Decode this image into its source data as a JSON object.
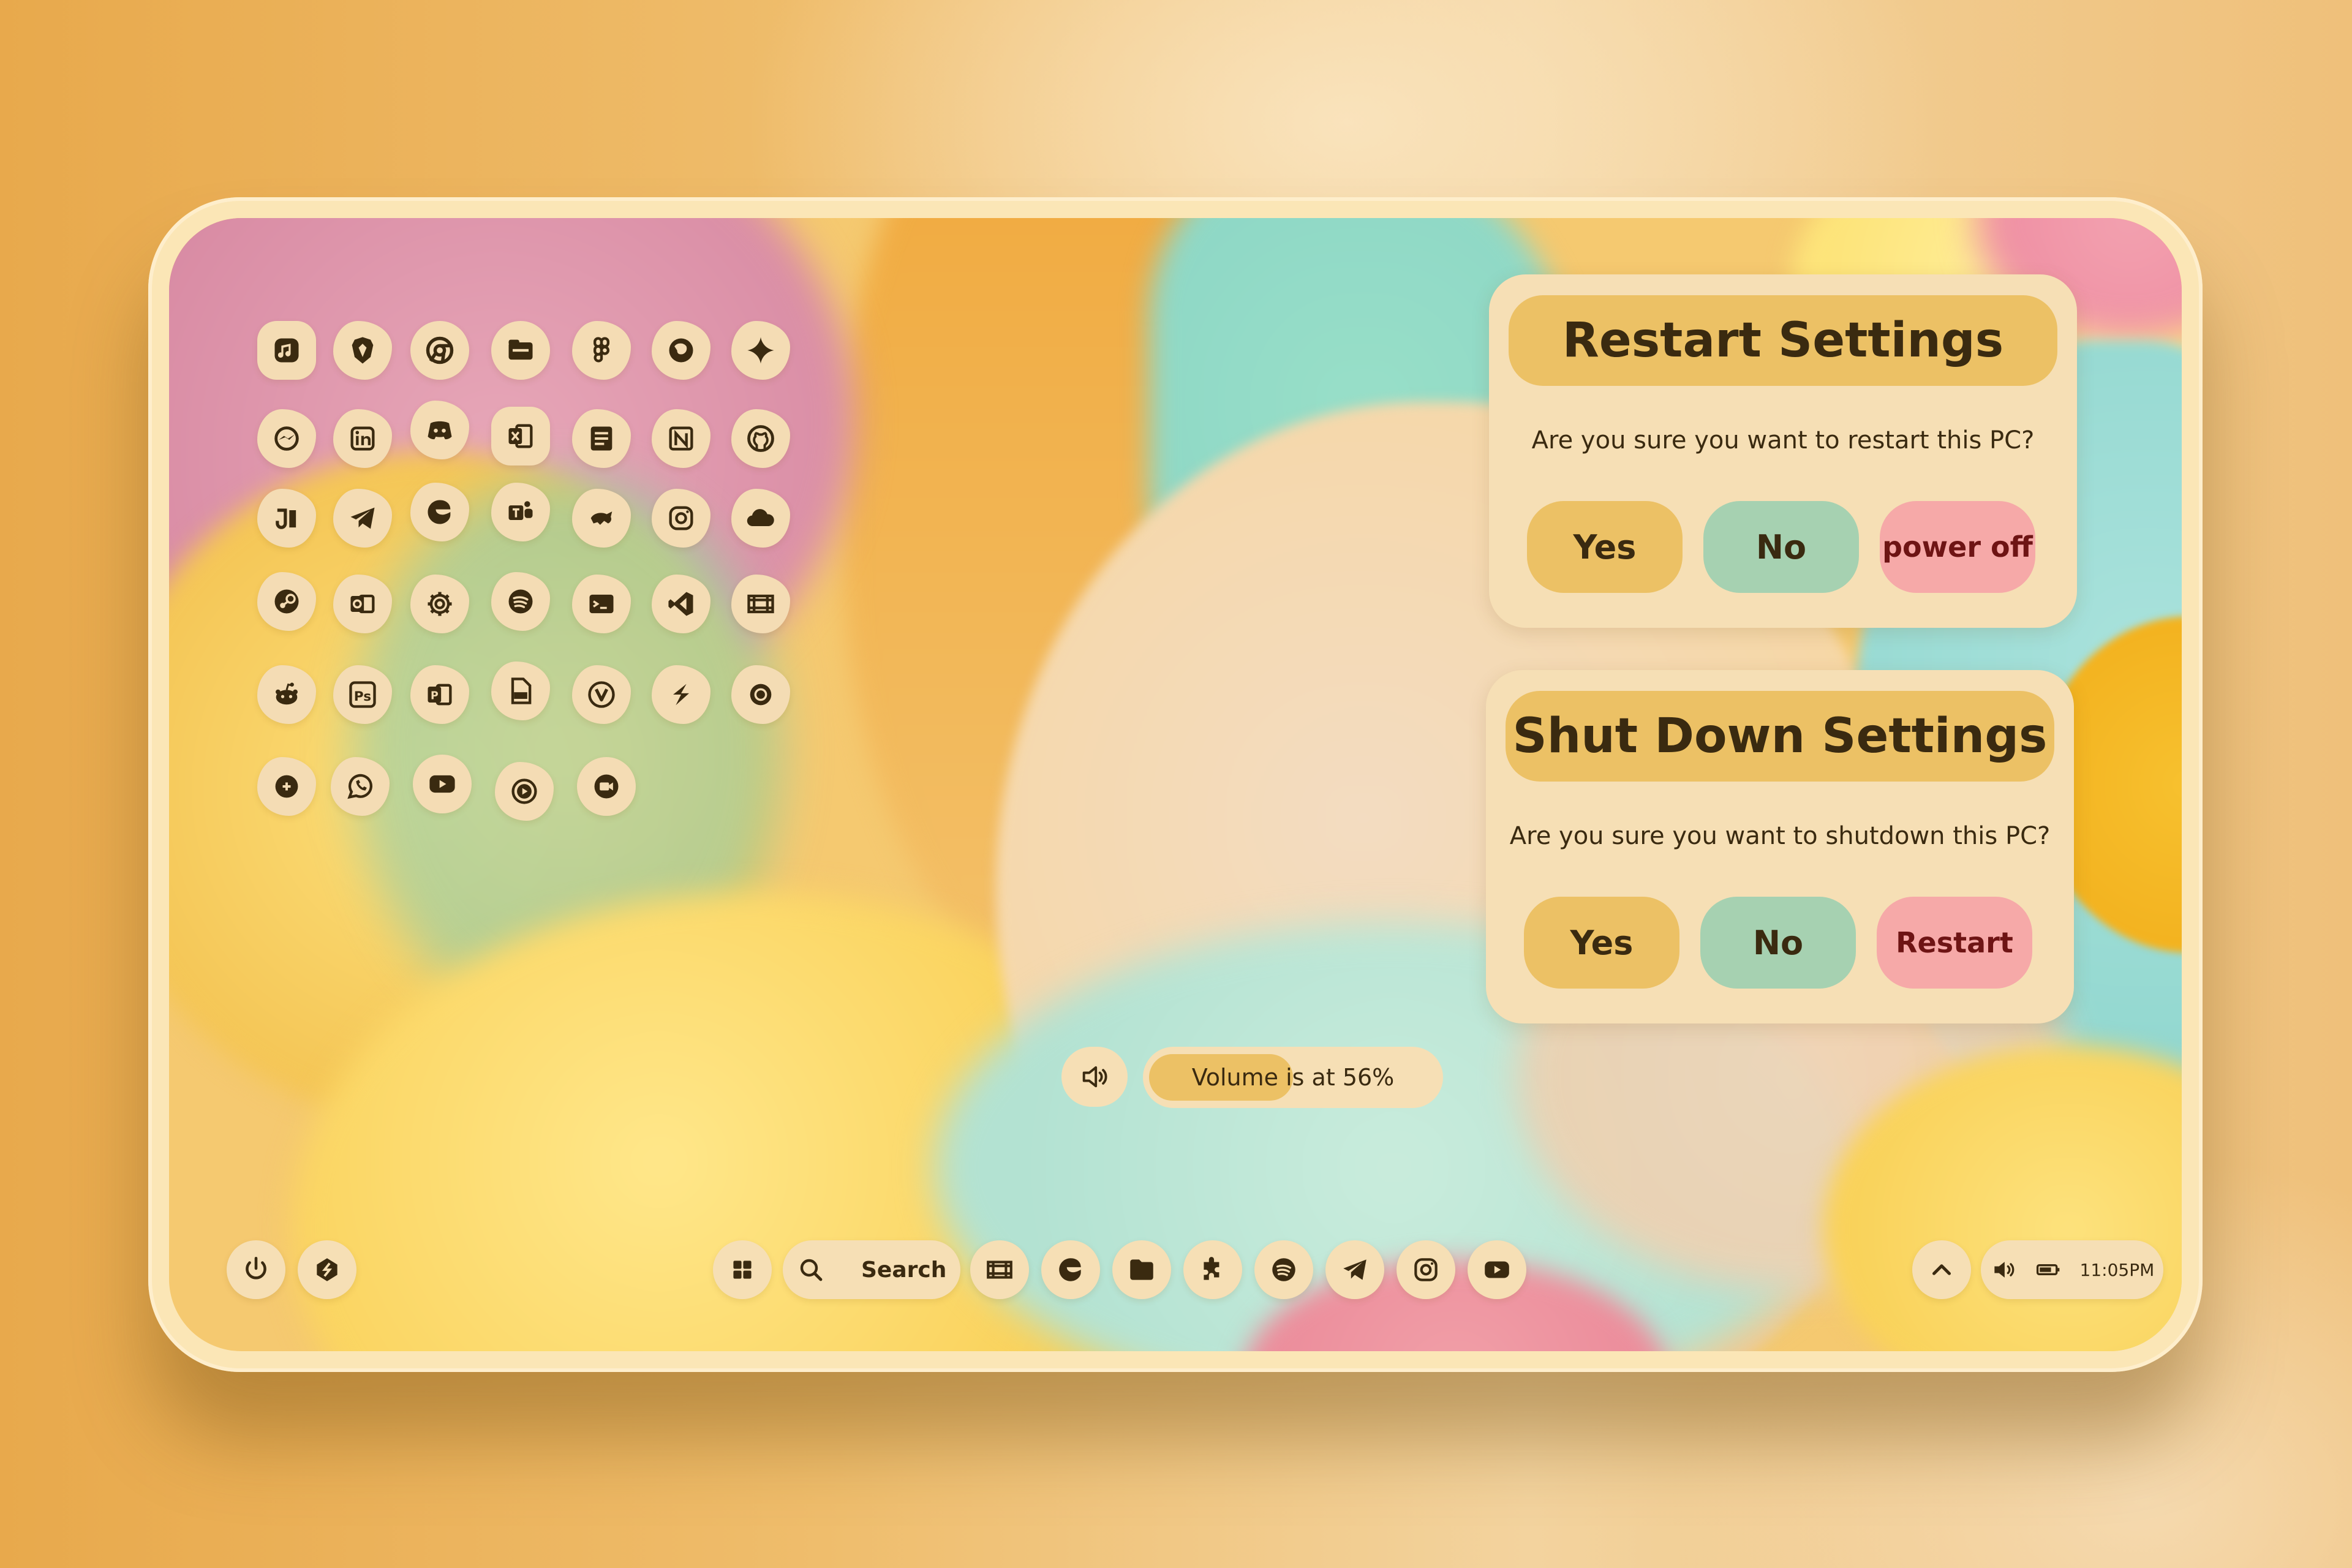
{
  "desktop_apps": [
    {
      "name": "apple-music-icon"
    },
    {
      "name": "brave-icon"
    },
    {
      "name": "chrome-icon"
    },
    {
      "name": "files-icon"
    },
    {
      "name": "figma-icon"
    },
    {
      "name": "firefox-icon"
    },
    {
      "name": "gemini-icon"
    },
    {
      "name": "messenger-icon"
    },
    {
      "name": "linkedin-icon"
    },
    {
      "name": "discord-icon"
    },
    {
      "name": "excel-icon"
    },
    {
      "name": "notes-icon"
    },
    {
      "name": "notion-icon"
    },
    {
      "name": "github-icon"
    },
    {
      "name": "jira-icon"
    },
    {
      "name": "telegram-icon"
    },
    {
      "name": "edge-icon"
    },
    {
      "name": "teams-icon"
    },
    {
      "name": "chameleon-icon"
    },
    {
      "name": "instagram-icon"
    },
    {
      "name": "onedrive-icon"
    },
    {
      "name": "steam-icon"
    },
    {
      "name": "outlook-icon"
    },
    {
      "name": "settings-icon"
    },
    {
      "name": "spotify-icon"
    },
    {
      "name": "terminal-icon"
    },
    {
      "name": "vscode-icon"
    },
    {
      "name": "film-icon"
    },
    {
      "name": "reddit-icon",
      "text": ""
    },
    {
      "name": "photoshop-icon",
      "text": "Ps"
    },
    {
      "name": "powerpoint-icon",
      "text": "P"
    },
    {
      "name": "pdf-icon",
      "text": ""
    },
    {
      "name": "vivaldi-icon",
      "text": ""
    },
    {
      "name": "stripe-icon",
      "text": ""
    },
    {
      "name": "obs-icon",
      "text": ""
    },
    {
      "name": "signal-icon"
    },
    {
      "name": "whatsapp-icon"
    },
    {
      "name": "youtube-icon"
    },
    {
      "name": "media-player-icon"
    },
    {
      "name": "meet-icon"
    }
  ],
  "restart_dialog": {
    "title": "Restart Settings",
    "question": "Are you sure you want to restart this PC?",
    "yes_label": "Yes",
    "no_label": "No",
    "alt_label": "power off"
  },
  "shutdown_dialog": {
    "title": "Shut Down Settings",
    "question": "Are you sure you want to shutdown this PC?",
    "yes_label": "Yes",
    "no_label": "No",
    "alt_label": "Restart"
  },
  "volume": {
    "text": "Volume is at 56%",
    "level": 0.56
  },
  "taskbar": {
    "search_label": "Search",
    "clock": "11:05PM"
  },
  "colors": {
    "panel": "#f6dfb5",
    "accent": "#ecc165",
    "green": "#a6d1b1",
    "red": "#f6a9a8"
  }
}
